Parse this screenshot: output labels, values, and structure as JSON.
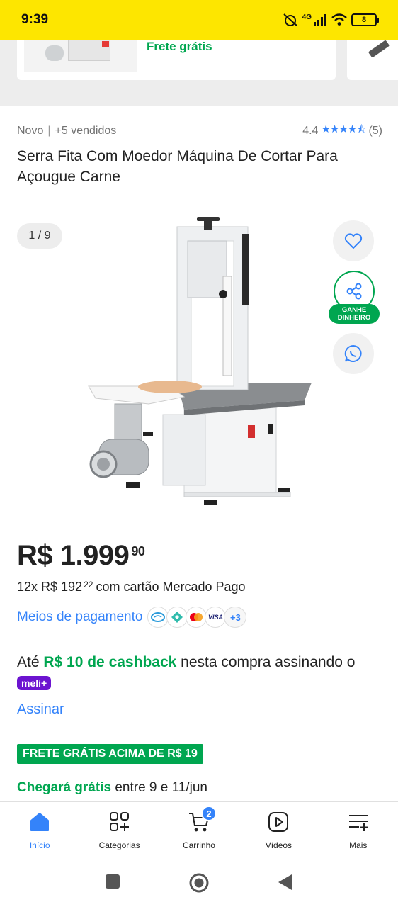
{
  "status_bar": {
    "time": "9:39",
    "network": "4G",
    "battery": "8"
  },
  "recommendation": {
    "shipping": "Frete grátis"
  },
  "product": {
    "condition": "Novo",
    "sold": "+5 vendidos",
    "rating": "4.4",
    "stars": "★★★★⯪",
    "reviews": "(5)",
    "title": "Serra Fita Com Moedor Máquina De Cortar Para Açougue Carne",
    "image_counter": "1 / 9",
    "share_badge_line1": "GANHE",
    "share_badge_line2": "DINHEIRO"
  },
  "price": {
    "main": "R$ 1.999",
    "cents": "90",
    "installments_prefix": "12x R$ 192",
    "installments_cents": "22",
    "installments_suffix": "com cartão Mercado Pago",
    "payment_methods_link": "Meios de pagamento",
    "more_methods": "+3",
    "visa": "VISA"
  },
  "cashback": {
    "prefix": "Até ",
    "amount": "R$ 10 de cashback",
    "middle": " nesta compra assinando o ",
    "badge": "meli+",
    "subscribe_link": "Assinar"
  },
  "shipping": {
    "free_tag": "FRETE GRÁTIS ACIMA DE R$ 19",
    "arrival_label": "Chegará grátis",
    "arrival_dates": " entre 9 e 11/jun"
  },
  "bottom_nav": {
    "items": [
      {
        "label": "Início",
        "active": true
      },
      {
        "label": "Categorias",
        "active": false
      },
      {
        "label": "Carrinho",
        "active": false
      },
      {
        "label": "Vídeos",
        "active": false
      },
      {
        "label": "Mais",
        "active": false
      }
    ],
    "cart_count": "2"
  },
  "colors": {
    "brand_yellow": "#fde600",
    "accent_blue": "#3483fa",
    "success_green": "#00a650",
    "meli_purple": "#6c14d0"
  },
  "icons": [
    "wifi-icon",
    "signal-icon",
    "battery-icon",
    "heart-icon",
    "share-icon",
    "whatsapp-icon",
    "home-icon",
    "categories-icon",
    "cart-icon",
    "video-icon",
    "menu-plus-icon"
  ]
}
